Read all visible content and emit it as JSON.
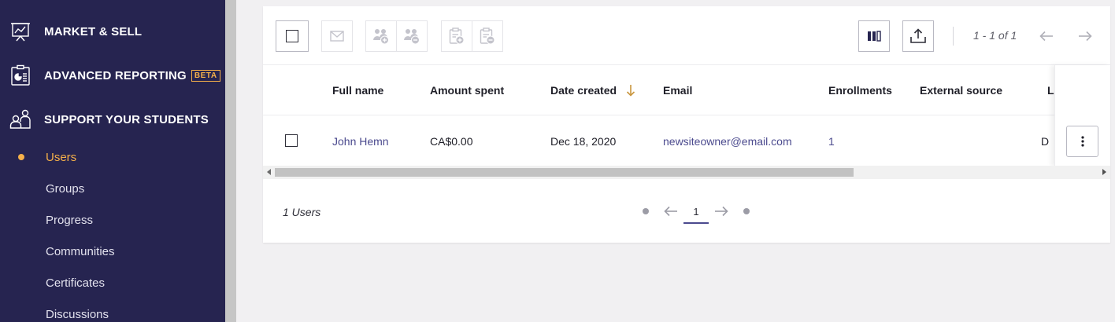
{
  "sidebar": {
    "sections": [
      {
        "label": "MARKET & SELL",
        "icon": "presentation-chart-icon"
      },
      {
        "label": "ADVANCED REPORTING",
        "icon": "clipboard-report-icon",
        "badge": "BETA"
      },
      {
        "label": "SUPPORT YOUR STUDENTS",
        "icon": "students-icon"
      }
    ],
    "items": [
      {
        "label": "Users",
        "active": true
      },
      {
        "label": "Groups"
      },
      {
        "label": "Progress"
      },
      {
        "label": "Communities"
      },
      {
        "label": "Certificates"
      },
      {
        "label": "Discussions"
      }
    ]
  },
  "toolbar": {
    "range_text": "1 - 1 of 1"
  },
  "table": {
    "columns": [
      "Full name",
      "Amount spent",
      "Date created",
      "Email",
      "Enrollments",
      "External source",
      "L"
    ],
    "sort_column": "Date created",
    "rows": [
      {
        "full_name": "John Hemn",
        "amount_spent": "CA$0.00",
        "date_created": "Dec 18, 2020",
        "email": "newsiteowner@email.com",
        "enrollments": "1",
        "external_source": "",
        "last": "D"
      }
    ]
  },
  "footer": {
    "count_text": "1 Users",
    "current_page": "1"
  },
  "colors": {
    "sidebar_bg": "#262450",
    "accent": "#f5b04a",
    "link": "#4b4a8e"
  }
}
